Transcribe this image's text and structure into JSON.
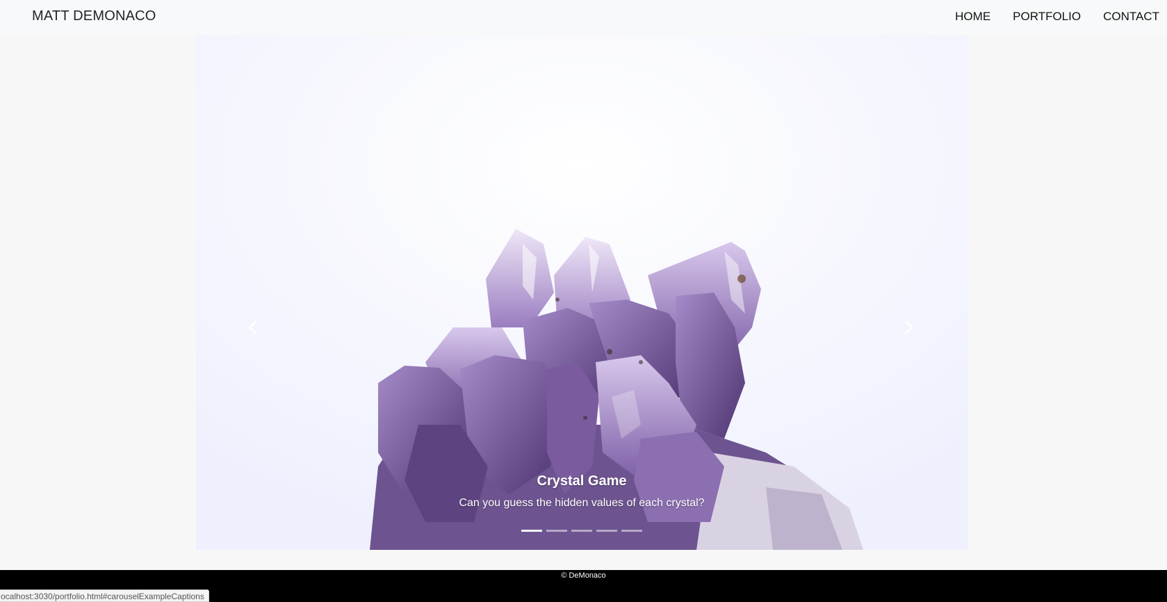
{
  "navbar": {
    "brand": "MATT DEMONACO",
    "links": [
      {
        "label": "HOME"
      },
      {
        "label": "PORTFOLIO"
      },
      {
        "label": "CONTACT"
      }
    ]
  },
  "carousel": {
    "active_index": 0,
    "slide_count": 5,
    "caption": {
      "title": "Crystal Game",
      "text": "Can you guess the hidden values of each crystal?"
    },
    "image": "amethyst-crystal-cluster",
    "colors": {
      "background": "#f3f4fe",
      "crystal_dark": "#5b4380",
      "crystal_mid": "#8b6fb0",
      "crystal_light": "#c9b6e0"
    }
  },
  "footer": {
    "text": "© DeMonaco"
  },
  "status_bar": {
    "url": "ocalhost:3030/portfolio.html#carouselExampleCaptions"
  }
}
